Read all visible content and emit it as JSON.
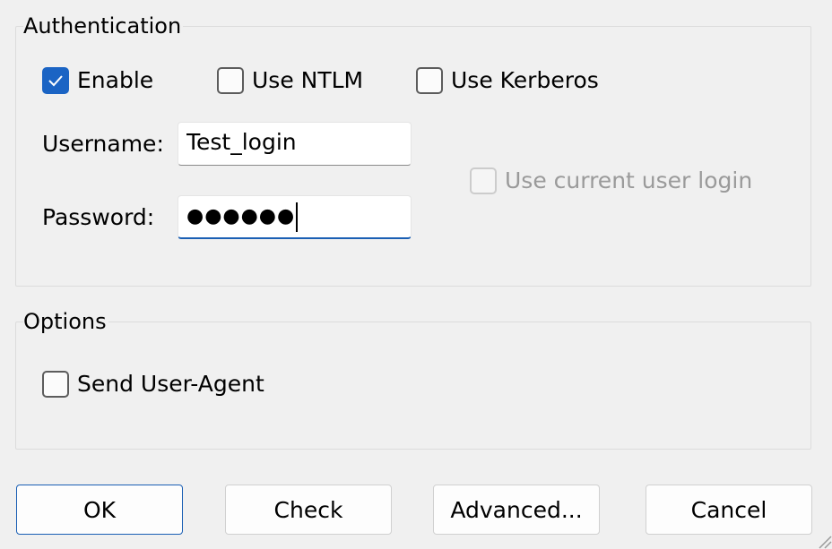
{
  "authentication": {
    "title": "Authentication",
    "enable": {
      "label": "Enable",
      "checked": true
    },
    "use_ntlm": {
      "label": "Use NTLM",
      "checked": false
    },
    "use_kerberos": {
      "label": "Use Kerberos",
      "checked": false
    },
    "username": {
      "label": "Username:",
      "value": "Test_login"
    },
    "password": {
      "label": "Password:",
      "masked_value": "●●●●●●"
    },
    "use_current_user_login": {
      "label": "Use current user login",
      "checked": false,
      "disabled": true
    }
  },
  "options": {
    "title": "Options",
    "send_user_agent": {
      "label": "Send User-Agent",
      "checked": false
    }
  },
  "buttons": {
    "ok": "OK",
    "check": "Check",
    "advanced": "Advanced...",
    "cancel": "Cancel"
  },
  "colors": {
    "accent": "#1b64c4",
    "background": "#f0f0f0",
    "disabled_text": "#9a9a9a"
  }
}
